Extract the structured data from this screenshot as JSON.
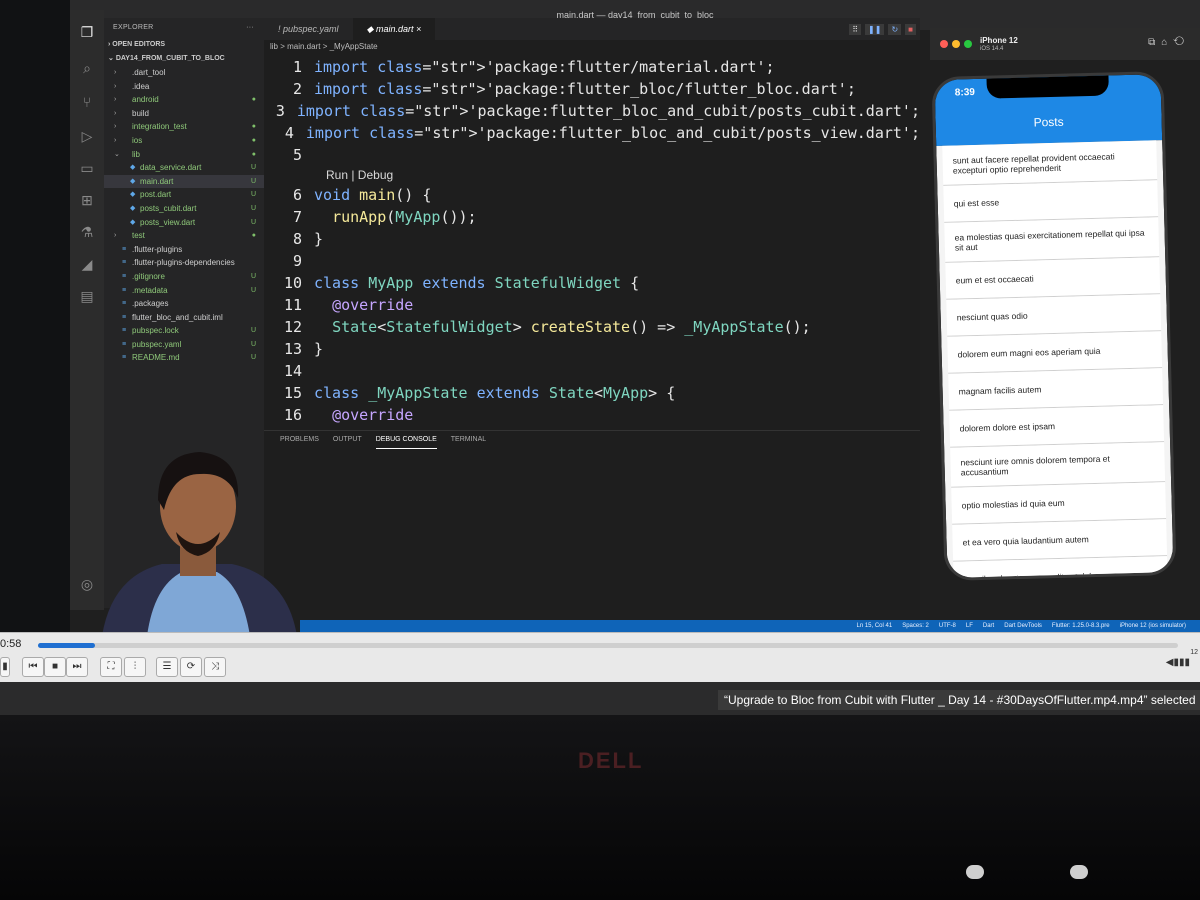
{
  "window": {
    "title": "main.dart — day14_from_cubit_to_bloc"
  },
  "explorer": {
    "header": "EXPLORER",
    "more": "···",
    "open_editors": "OPEN EDITORS",
    "project": "DAY14_FROM_CUBIT_TO_BLOC",
    "items": [
      {
        "label": ".dart_tool",
        "type": "folder",
        "status": ""
      },
      {
        "label": ".idea",
        "type": "folder",
        "status": ""
      },
      {
        "label": "android",
        "type": "folder",
        "status": "●"
      },
      {
        "label": "build",
        "type": "folder",
        "status": ""
      },
      {
        "label": "integration_test",
        "type": "folder",
        "status": "●"
      },
      {
        "label": "ios",
        "type": "folder",
        "status": "●"
      },
      {
        "label": "lib",
        "type": "folder-open",
        "status": "●"
      },
      {
        "label": "data_service.dart",
        "type": "dart",
        "status": "U"
      },
      {
        "label": "main.dart",
        "type": "dart",
        "status": "U"
      },
      {
        "label": "post.dart",
        "type": "dart",
        "status": "U"
      },
      {
        "label": "posts_cubit.dart",
        "type": "dart",
        "status": "U"
      },
      {
        "label": "posts_view.dart",
        "type": "dart",
        "status": "U"
      },
      {
        "label": "test",
        "type": "folder",
        "status": "●"
      },
      {
        "label": ".flutter-plugins",
        "type": "file",
        "status": ""
      },
      {
        "label": ".flutter-plugins-dependencies",
        "type": "file",
        "status": ""
      },
      {
        "label": ".gitignore",
        "type": "file",
        "status": "U"
      },
      {
        "label": ".metadata",
        "type": "file",
        "status": "U"
      },
      {
        "label": ".packages",
        "type": "file",
        "status": ""
      },
      {
        "label": "flutter_bloc_and_cubit.iml",
        "type": "file",
        "status": ""
      },
      {
        "label": "pubspec.lock",
        "type": "file",
        "status": "U"
      },
      {
        "label": "pubspec.yaml",
        "type": "file",
        "status": "U"
      },
      {
        "label": "README.md",
        "type": "file",
        "status": "U"
      }
    ]
  },
  "editor": {
    "tabs": [
      {
        "label": "pubspec.yaml"
      },
      {
        "label": "main.dart"
      }
    ],
    "breadcrumb": "lib > main.dart > _MyAppState",
    "code_lens": "Run | Debug",
    "lines": [
      {
        "n": "1",
        "code": "import 'package:flutter/material.dart';"
      },
      {
        "n": "2",
        "code": "import 'package:flutter_bloc/flutter_bloc.dart';"
      },
      {
        "n": "3",
        "code": "import 'package:flutter_bloc_and_cubit/posts_cubit.dart';"
      },
      {
        "n": "4",
        "code": "import 'package:flutter_bloc_and_cubit/posts_view.dart';"
      },
      {
        "n": "5",
        "code": ""
      },
      {
        "n": "6",
        "code": "void main() {"
      },
      {
        "n": "7",
        "code": "  runApp(MyApp());"
      },
      {
        "n": "8",
        "code": "}"
      },
      {
        "n": "9",
        "code": ""
      },
      {
        "n": "10",
        "code": "class MyApp extends StatefulWidget {"
      },
      {
        "n": "11",
        "code": "  @override"
      },
      {
        "n": "12",
        "code": "  State<StatefulWidget> createState() => _MyAppState();"
      },
      {
        "n": "13",
        "code": "}"
      },
      {
        "n": "14",
        "code": ""
      },
      {
        "n": "15",
        "code": "class _MyAppState extends State<MyApp> {"
      },
      {
        "n": "16",
        "code": "  @override"
      }
    ]
  },
  "panel": {
    "tabs": [
      "PROBLEMS",
      "OUTPUT",
      "DEBUG CONSOLE",
      "TERMINAL"
    ],
    "active": "DEBUG CONSOLE"
  },
  "status_bar": {
    "items": [
      "Ln 15, Col 41",
      "Spaces: 2",
      "UTF-8",
      "LF",
      "Dart",
      "Dart DevTools",
      "Flutter: 1.25.0-8.3.pre",
      "iPhone 12 (ios simulator)"
    ]
  },
  "simulator": {
    "device": "iPhone 12",
    "os": "iOS 14.4",
    "time": "8:39",
    "app_title": "Posts",
    "posts": [
      "sunt aut facere repellat provident occaecati excepturi optio reprehenderit",
      "qui est esse",
      "ea molestias quasi exercitationem repellat qui ipsa sit aut",
      "eum et est occaecati",
      "nesciunt quas odio",
      "dolorem eum magni eos aperiam quia",
      "magnam facilis autem",
      "dolorem dolore est ipsam",
      "nesciunt iure omnis dolorem tempora et accusantium",
      "optio molestias id quia eum",
      "et ea vero quia laudantium autem",
      "in quibusdam tempore odit est dolorem"
    ]
  },
  "player": {
    "time": "0:58",
    "progress": 0.05,
    "volume_label": "12"
  },
  "file_label": "“Upgrade to Bloc from Cubit with Flutter _ Day 14 - #30DaysOfFlutter.mp4.mp4” selected",
  "bezel": {
    "brand": "DELL"
  },
  "colors": {
    "accent": "#1e88e5",
    "status_bar": "#0f64b8",
    "editor_bg": "#1e1e1e"
  }
}
